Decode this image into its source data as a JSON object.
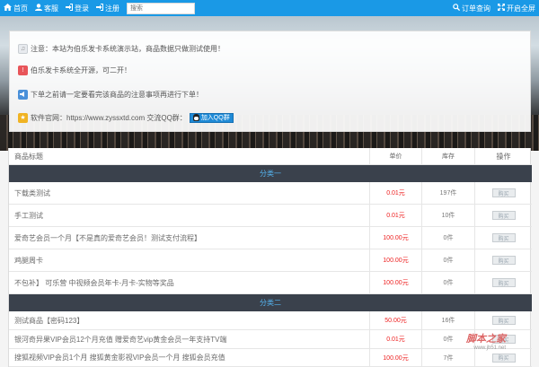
{
  "navbar": {
    "home": "首页",
    "service": "客服",
    "login": "登录",
    "register": "注册",
    "search_placeholder": "搜索",
    "order_query": "订单查询",
    "fullscreen": "开启全屏"
  },
  "notices": [
    {
      "text": "注意：本站为伯乐发卡系统演示站，商品数据只做测试使用！",
      "color": "#e8ebef",
      "icon": "bell-icon"
    },
    {
      "text": "伯乐发卡系统全开源，可二开！",
      "color": "#e8555a",
      "icon": "info-icon"
    },
    {
      "text": "下单之前请一定要看完该商品的注意事项再进行下单！",
      "color": "#4a90d9",
      "icon": "megaphone-icon"
    },
    {
      "text": "软件官网：https://www.zyssxtd.com 交流QQ群：",
      "color": "#f0b323",
      "icon": "star-icon"
    }
  ],
  "qq_button": "加入QQ群",
  "table": {
    "headers": [
      "商品标题",
      "单价",
      "库存",
      "操作"
    ],
    "categories": [
      {
        "name": "分类一",
        "items": [
          {
            "title": "下载类测试",
            "price": "0.01元",
            "stock": "197件",
            "action": "购买"
          },
          {
            "title": "手工测试",
            "price": "0.01元",
            "stock": "10件",
            "action": "购买"
          },
          {
            "title": "爱奇艺会员一个月【不是真的爱奇艺会员！测试支付流程】",
            "price": "100.00元",
            "stock": "0件",
            "action": "购买"
          },
          {
            "title": "鸡腿周卡",
            "price": "100.00元",
            "stock": "0件",
            "action": "购买"
          },
          {
            "title": "不包补】 可乐营 中视频会员年卡-月卡-实物等奖品",
            "price": "100.00元",
            "stock": "0件",
            "action": "购买"
          }
        ]
      },
      {
        "name": "分类二",
        "items": [
          {
            "title": "测试商品【密码123】",
            "price": "50.00元",
            "stock": "16件",
            "action": "购买"
          },
          {
            "title": "银河奇异果VIP会员12个月充值 赠爱奇艺vip黄金会员一年支持TV端",
            "price": "0.01元",
            "stock": "0件",
            "action": "购买"
          },
          {
            "title": "搜狐视频VIP会员1个月 搜狐黄金影视VIP会员一个月 搜狐会员充值",
            "price": "100.00元",
            "stock": "7件",
            "action": "购买"
          }
        ]
      }
    ]
  },
  "watermark": {
    "title": "脚本之家",
    "url": "www.jb51.net"
  }
}
